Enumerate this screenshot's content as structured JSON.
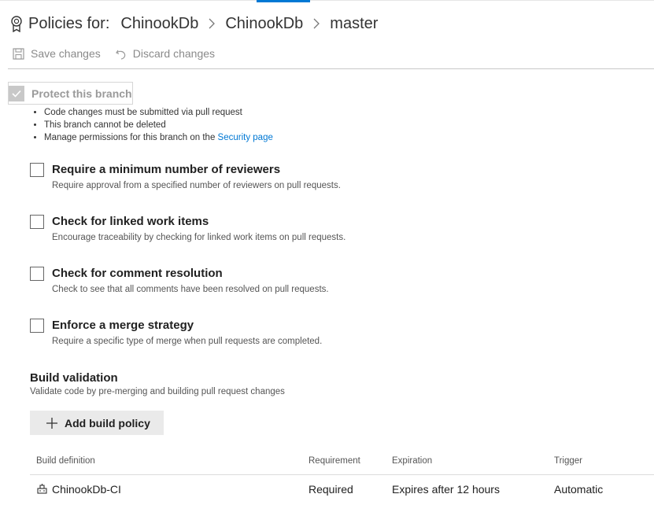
{
  "header": {
    "title_prefix": "Policies for:",
    "breadcrumbs": [
      "ChinookDb",
      "ChinookDb",
      "master"
    ]
  },
  "toolbar": {
    "save_label": "Save changes",
    "discard_label": "Discard changes"
  },
  "protect": {
    "label": "Protect this branch",
    "checked": true,
    "bullets": [
      "Code changes must be submitted via pull request",
      "This branch cannot be deleted"
    ],
    "permissions_prefix": "Manage permissions for this branch on the ",
    "security_link": "Security page"
  },
  "policies": [
    {
      "title": "Require a minimum number of reviewers",
      "description": "Require approval from a specified number of reviewers on pull requests."
    },
    {
      "title": "Check for linked work items",
      "description": "Encourage traceability by checking for linked work items on pull requests."
    },
    {
      "title": "Check for comment resolution",
      "description": "Check to see that all comments have been resolved on pull requests."
    },
    {
      "title": "Enforce a merge strategy",
      "description": "Require a specific type of merge when pull requests are completed."
    }
  ],
  "build_validation": {
    "title": "Build validation",
    "subtitle": "Validate code by pre-merging and building pull request changes",
    "add_label": "Add build policy",
    "columns": [
      "Build definition",
      "Requirement",
      "Expiration",
      "Trigger"
    ],
    "rows": [
      {
        "definition": "ChinookDb-CI",
        "requirement": "Required",
        "expiration": "Expires after 12 hours",
        "trigger": "Automatic"
      }
    ]
  },
  "colors": {
    "accent": "#0078d4",
    "link": "#0078d4"
  },
  "icons": {
    "policy": "award-ribbon-icon",
    "save": "save-icon",
    "discard": "undo-icon",
    "add": "plus-icon",
    "build": "build-icon",
    "chevron": "chevron-right-icon"
  }
}
